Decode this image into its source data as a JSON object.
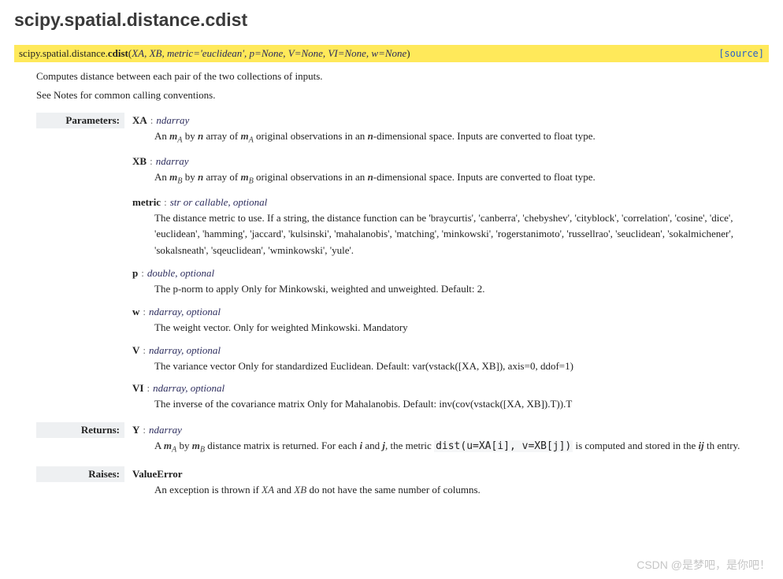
{
  "page_title": "scipy.spatial.distance.cdist",
  "signature": {
    "module_path": "scipy.spatial.distance.",
    "func_name": "cdist",
    "args_open": "(",
    "args": "XA, XB, metric='euclidean', p=None, V=None, VI=None, w=None",
    "args_close": ")",
    "source_label": "[source]"
  },
  "intro": "Computes distance between each pair of the two collections of inputs.",
  "notes_line": "See Notes for common calling conventions.",
  "labels": {
    "parameters": "Parameters:",
    "returns": "Returns:",
    "raises": "Raises:"
  },
  "params": {
    "XA": {
      "name": "XA",
      "type": "ndarray",
      "desc_pre": "An ",
      "m_sym": "m",
      "m_sub": "A",
      "desc_mid1": " by ",
      "n_sym": "n",
      "desc_mid2": " array of ",
      "desc_mid3": " original observations in an ",
      "desc_post": "-dimensional space. Inputs are converted to float type."
    },
    "XB": {
      "name": "XB",
      "type": "ndarray",
      "desc_pre": "An ",
      "m_sym": "m",
      "m_sub": "B",
      "desc_mid1": " by ",
      "n_sym": "n",
      "desc_mid2": " array of ",
      "desc_mid3": " original observations in an ",
      "desc_post": "-dimensional space. Inputs are converted to float type."
    },
    "metric": {
      "name": "metric",
      "type": "str or callable, optional",
      "desc": "The distance metric to use. If a string, the distance function can be 'braycurtis', 'canberra', 'chebyshev', 'cityblock', 'correlation', 'cosine', 'dice', 'euclidean', 'hamming', 'jaccard', 'kulsinski', 'mahalanobis', 'matching', 'minkowski', 'rogerstanimoto', 'russellrao', 'seuclidean', 'sokalmichener', 'sokalsneath', 'sqeuclidean', 'wminkowski', 'yule'."
    },
    "p": {
      "name": "p",
      "type": "double, optional",
      "desc": "The p-norm to apply Only for Minkowski, weighted and unweighted. Default: 2."
    },
    "w": {
      "name": "w",
      "type": "ndarray, optional",
      "desc": "The weight vector. Only for weighted Minkowski. Mandatory"
    },
    "V": {
      "name": "V",
      "type": "ndarray, optional",
      "desc": "The variance vector Only for standardized Euclidean. Default: var(vstack([XA, XB]), axis=0, ddof=1)"
    },
    "VI": {
      "name": "VI",
      "type": "ndarray, optional",
      "desc": "The inverse of the covariance matrix Only for Mahalanobis. Default: inv(cov(vstack([XA, XB]).T)).T"
    }
  },
  "returns": {
    "Y": {
      "name": "Y",
      "type": "ndarray",
      "desc_pre": "A ",
      "mA": "m",
      "mA_sub": "A",
      "by": " by ",
      "mB": "m",
      "mB_sub": "B",
      "desc_mid1": " distance matrix is returned. For each ",
      "i_sym": "i",
      "and": " and ",
      "j_sym": "j",
      "desc_mid2": ", the metric ",
      "code": "dist(u=XA[i], v=XB[j])",
      "desc_mid3": " is computed and stored in the ",
      "ij_sym": "ij",
      "desc_post": " th entry."
    }
  },
  "raises": {
    "err_name": "ValueError",
    "desc_pre": "An exception is thrown if ",
    "XA": "XA",
    "and": " and ",
    "XB": "XB",
    "desc_post": " do not have the same number of columns."
  },
  "watermark": "CSDN @是梦吧，是你吧！"
}
